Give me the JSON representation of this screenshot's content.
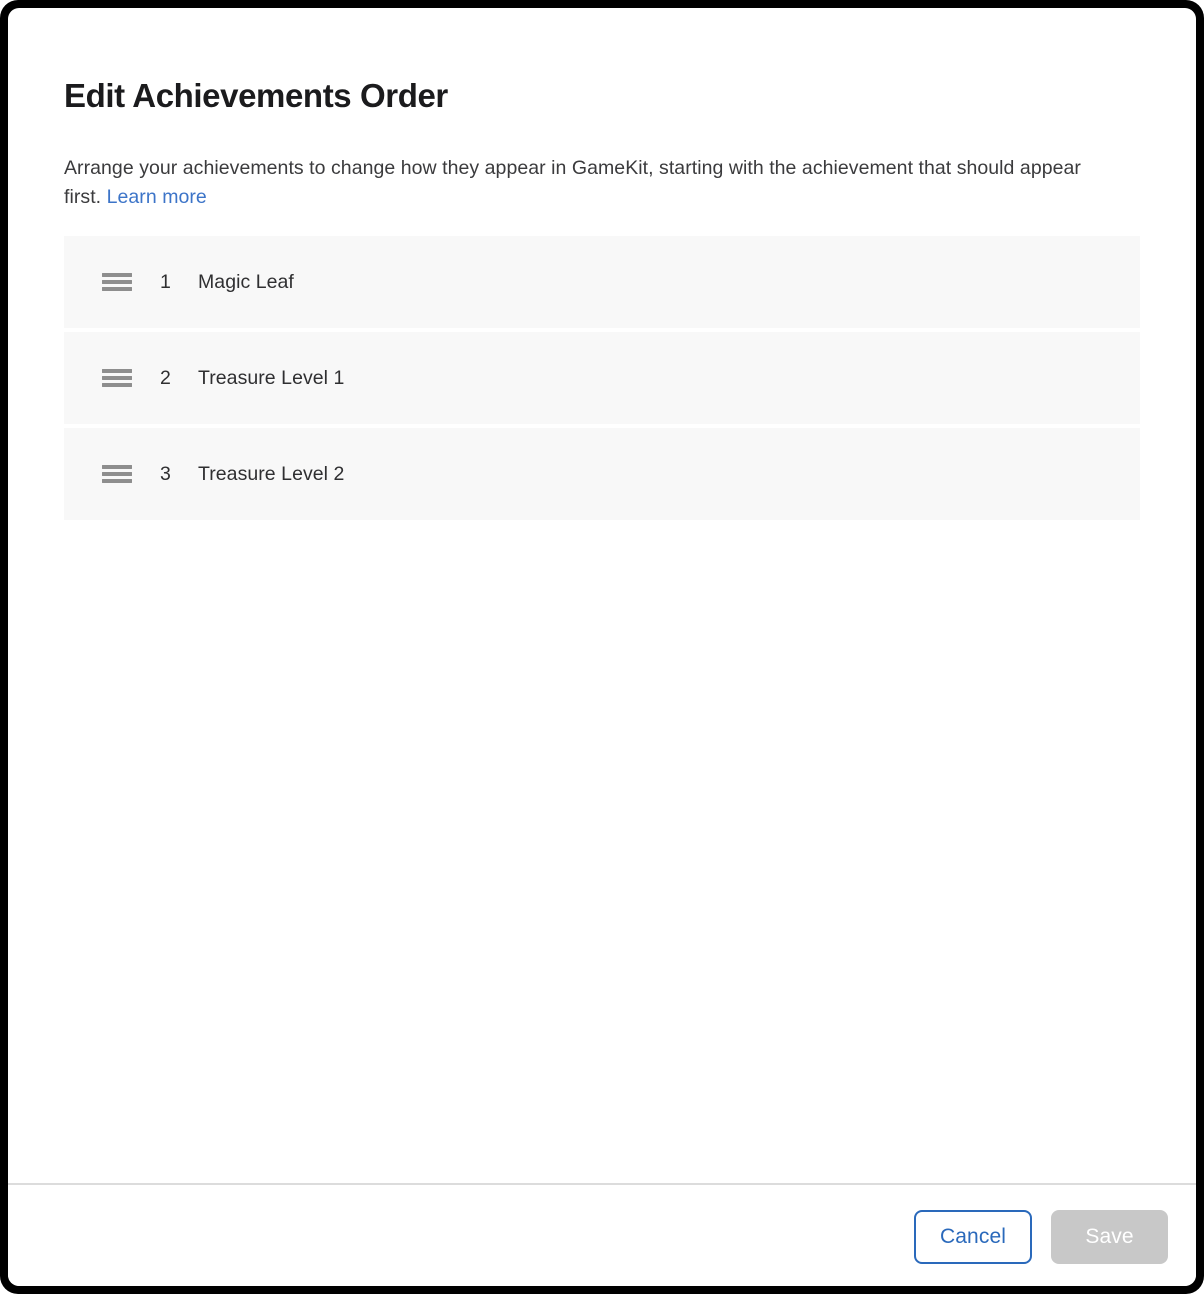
{
  "dialog": {
    "title": "Edit Achievements Order",
    "description_before_link": "Arrange your achievements to change how they appear in GameKit, starting with the achievement that should appear first.",
    "learn_more_label": "Learn more"
  },
  "list": {
    "rows": [
      {
        "index": "1",
        "label": "Magic Leaf",
        "handle_icon": "drag-handle-icon"
      },
      {
        "index": "2",
        "label": "Treasure Level 1",
        "handle_icon": "drag-handle-icon"
      },
      {
        "index": "3",
        "label": "Treasure Level 2",
        "handle_icon": "drag-handle-icon"
      }
    ]
  },
  "footer": {
    "cancel_label": "Cancel",
    "save_label": "Save"
  },
  "colors": {
    "link": "#3c74c8",
    "cancel_border": "#2a69bb",
    "save_disabled_bg": "#c8c8c8",
    "row_bg": "#f8f8f8",
    "title": "#1b1b1d",
    "frame": "#000000"
  }
}
